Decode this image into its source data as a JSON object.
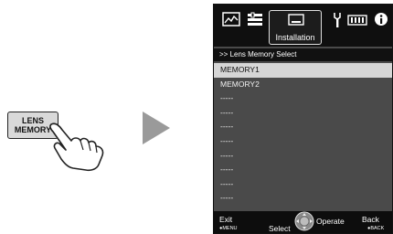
{
  "remote": {
    "key_line1": "LENS",
    "key_line2": "MEMORY"
  },
  "osd": {
    "tabs": [
      {
        "icon": "picture-adjust-icon"
      },
      {
        "icon": "input-signal-icon"
      },
      {
        "icon": "installation-icon",
        "label": "Installation"
      },
      {
        "icon": "tool-icon"
      },
      {
        "icon": "function-icon"
      },
      {
        "icon": "info-icon"
      }
    ],
    "title": ">> Lens Memory Select",
    "items": [
      "MEMORY1",
      "MEMORY2",
      "-----",
      "-----",
      "-----",
      "-----",
      "-----",
      "-----",
      "-----",
      "-----"
    ],
    "selected_index": 0,
    "footer": {
      "exit": "Exit",
      "menu": "●MENU",
      "select": "Select",
      "operate": "Operate",
      "back": "Back",
      "back_sub": "●BACK"
    }
  },
  "colors": {
    "osd_bg": "#4a4a4a",
    "bar_bg": "#0f0f0f",
    "selected_bg": "#d6d6d6"
  }
}
